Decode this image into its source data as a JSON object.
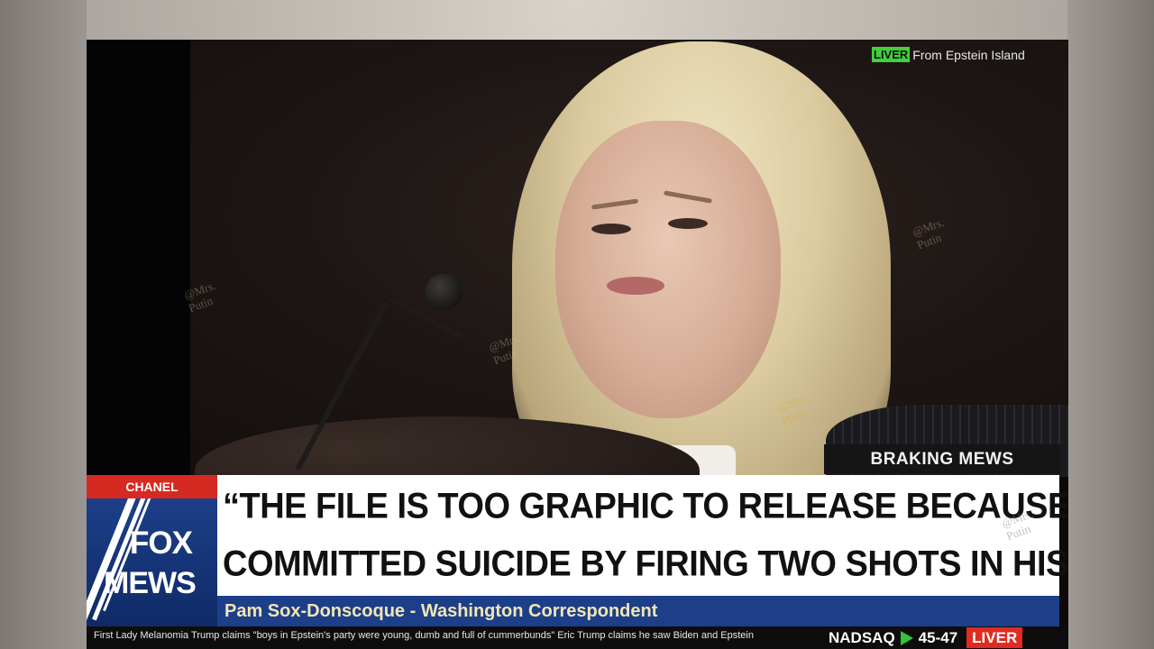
{
  "top_overlay": {
    "live_badge": "LIVER",
    "location": "From Epstein Island"
  },
  "watermarks": [
    "@Mrs.\nPutin",
    "@Mrs.\nPutin",
    "@Mrs.\nPutin",
    "@Mrs.\nPutin",
    "@Mrs.\nPutin"
  ],
  "lower_third": {
    "section_tag": "BRAKING MEWS",
    "channel_label": "CHANEL",
    "logo_top": "FOX",
    "logo_bottom": "MEWS",
    "headline_line1": "“THE FILE IS TOO GRAPHIC TO RELEASE BECAUSE EPSTEIN",
    "headline_line2": "COMMITTED SUICIDE BY FIRING TWO SHOTS IN HIS HEAD”",
    "byline": "Pam Sox-Donscoque -  Washington Correspondent"
  },
  "ticker": {
    "text": "First Lady Melanomia Trump claims \"boys in Epstein's party were young, dumb and full of cummerbunds\"   Eric Trump claims he saw Biden and Epstein",
    "market_symbol": "NADSAQ",
    "market_value": "45-47",
    "live_label": "LIVER"
  },
  "colors": {
    "brand_blue": "#1d3f89",
    "alert_red": "#d52a22",
    "live_green": "#3fd23a",
    "byline_gold": "#f1e6b5"
  }
}
